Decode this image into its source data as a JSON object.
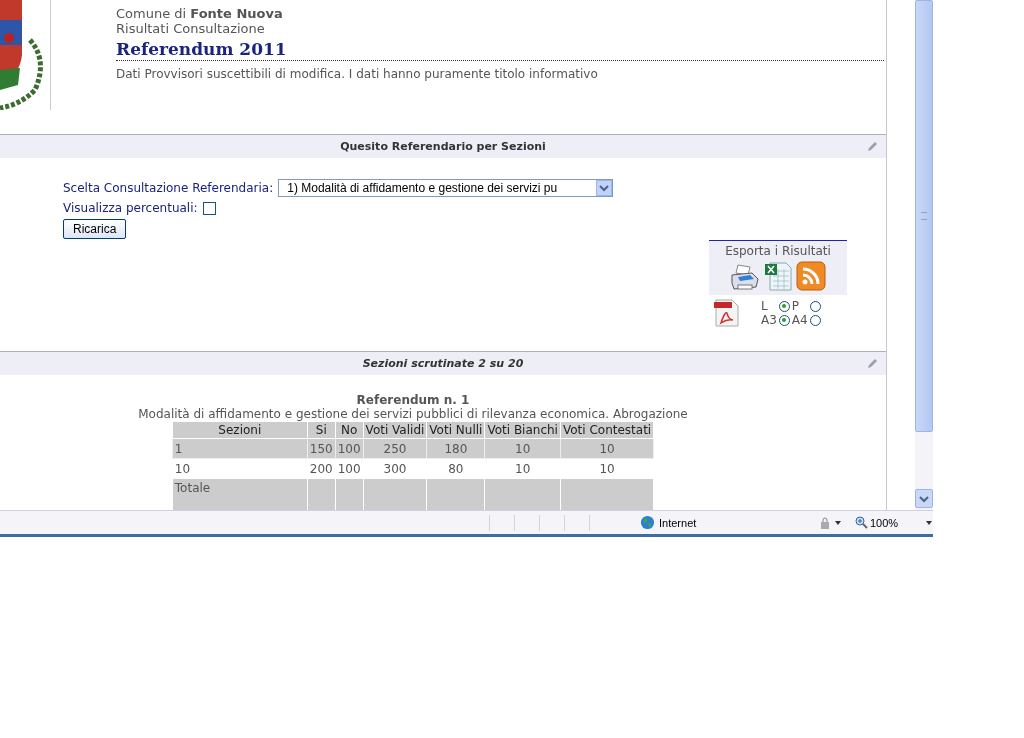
{
  "header": {
    "municipality": "Comune di **Fonte Nuova**",
    "subtitle": "Risultati Consultazione",
    "title": "Referendum 2011",
    "notice": "Dati Provvisori suscettibili di modifica. I dati hanno puramente titolo informativo"
  },
  "query_panel": {
    "title": "Quesito Referendario per Sezioni",
    "select_label": "Scelta Consultazione Referendaria:",
    "select_value": "1) Modalità di affidamento e gestione dei servizi pu",
    "percent_label": "Visualizza percentuali:",
    "percent_checked": false,
    "reload_button": "Ricarica",
    "export": {
      "title": "Esporta i Risultati",
      "orientation": [
        {
          "label": "L",
          "selected": true
        },
        {
          "label": "P",
          "selected": false
        }
      ],
      "paper": [
        {
          "label": "A3",
          "selected": true
        },
        {
          "label": "A4",
          "selected": false
        }
      ]
    }
  },
  "results_panel": {
    "title": "Sezioni scrutinate 2 su 20",
    "referendum_title": "Referendum n. 1",
    "referendum_question": "Modalità di affidamento e gestione dei servizi pubblici di rilevanza economica. Abrogazione",
    "table": {
      "columns": [
        "Sezioni",
        "Si",
        "No",
        "Voti Validi",
        "Voti Nulli",
        "Voti Bianchi",
        "Voti Contestati"
      ],
      "rows": [
        {
          "cells": [
            "1",
            "150",
            "100",
            "250",
            "180",
            "10",
            "10"
          ]
        },
        {
          "cells": [
            "10",
            "200",
            "100",
            "300",
            "80",
            "10",
            "10"
          ]
        }
      ],
      "total_label": "Totale"
    }
  },
  "status_bar": {
    "zone": "Internet",
    "zoom": "100%"
  }
}
